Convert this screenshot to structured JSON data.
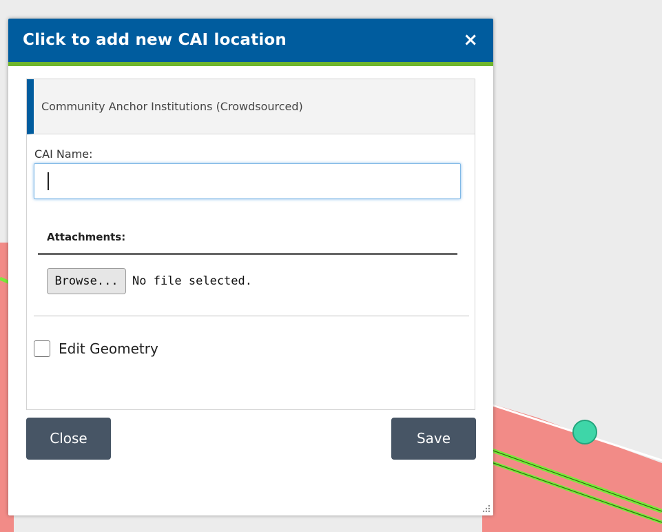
{
  "dialog": {
    "title": "Click to add new CAI location",
    "close_glyph": "×",
    "header_color": "#005c9e",
    "accent_color": "#6fb52c"
  },
  "form": {
    "layer_name": "Community Anchor Institutions (Crowdsourced)",
    "cai_name_label": "CAI Name:",
    "cai_name_value": "",
    "attachments_label": "Attachments:",
    "browse_label": "Browse...",
    "file_status": "No file selected.",
    "edit_geometry_label": "Edit Geometry",
    "edit_geometry_checked": false
  },
  "buttons": {
    "close_label": "Close",
    "save_label": "Save",
    "button_color": "#475565"
  },
  "map": {
    "parcel_color": "#f28b87",
    "road_color": "#7be83b",
    "point_color": "#3ed6a8"
  }
}
